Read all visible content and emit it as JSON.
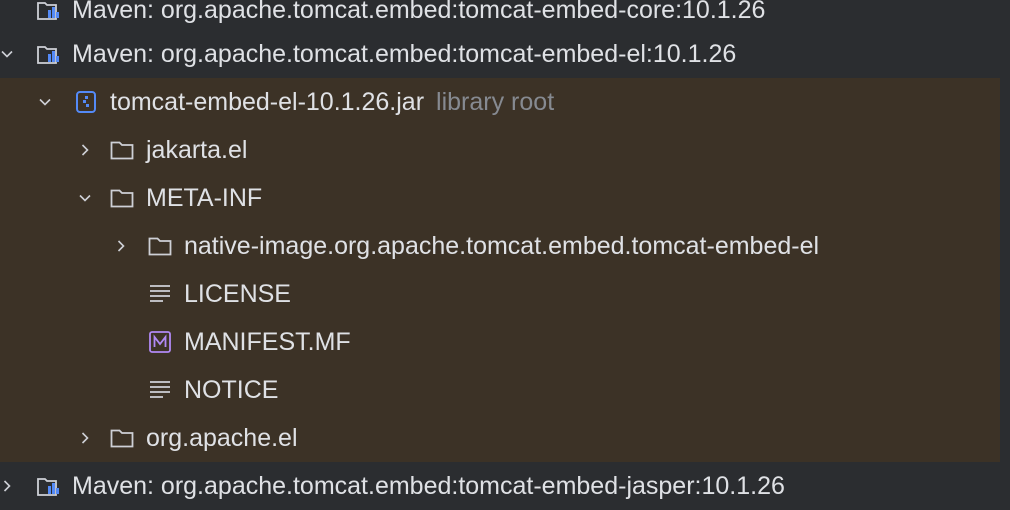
{
  "tree": {
    "rows": [
      {
        "label": "Maven: org.apache.tomcat.embed:tomcat-embed-core:10.1.26",
        "icon": "maven-library-icon",
        "expanded": false
      },
      {
        "label": "Maven: org.apache.tomcat.embed:tomcat-embed-el:10.1.26",
        "icon": "maven-library-icon",
        "expanded": true
      },
      {
        "label": "tomcat-embed-el-10.1.26.jar",
        "hint": "library root",
        "icon": "jar-icon",
        "expanded": true
      },
      {
        "label": "jakarta.el",
        "icon": "folder-icon",
        "expanded": false
      },
      {
        "label": "META-INF",
        "icon": "folder-icon",
        "expanded": true
      },
      {
        "label": "native-image.org.apache.tomcat.embed.tomcat-embed-el",
        "icon": "folder-icon",
        "expanded": false
      },
      {
        "label": "LICENSE",
        "icon": "text-file-icon"
      },
      {
        "label": "MANIFEST.MF",
        "icon": "manifest-file-icon"
      },
      {
        "label": "NOTICE",
        "icon": "text-file-icon"
      },
      {
        "label": "org.apache.el",
        "icon": "folder-icon",
        "expanded": false
      },
      {
        "label": "Maven: org.apache.tomcat.embed:tomcat-embed-jasper:10.1.26",
        "icon": "maven-library-icon",
        "expanded": false
      }
    ]
  },
  "colors": {
    "background": "#2b2d30",
    "highlight": "#3c3226",
    "text": "#dfe1e5",
    "hint": "#868a91",
    "jar_accent": "#548af7",
    "manifest_accent": "#b189f5"
  }
}
